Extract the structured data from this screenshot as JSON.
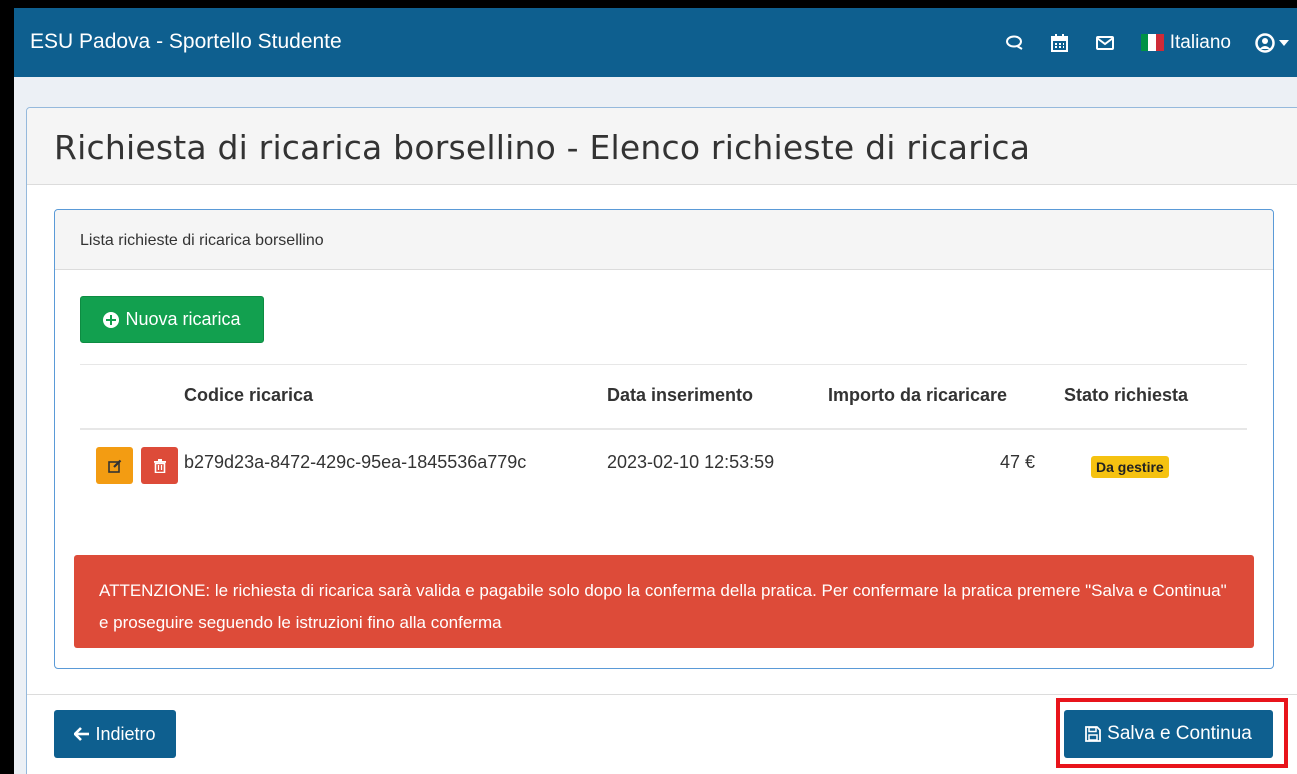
{
  "app": {
    "title": "ESU Padova - Sportello Studente",
    "language": "Italiano",
    "nav_icons": [
      "comments-icon",
      "calendar-icon",
      "envelope-icon",
      "user-circle-icon"
    ],
    "brand_color": "#0e5f8f"
  },
  "page": {
    "title": "Richiesta di ricarica borsellino - Elenco richieste di ricarica"
  },
  "panel": {
    "heading": "Lista richieste di ricarica borsellino",
    "new_button_label": "Nuova ricarica"
  },
  "table": {
    "headers": [
      "Codice ricarica",
      "Data inserimento",
      "Importo da ricaricare",
      "Stato richiesta"
    ],
    "rows": [
      {
        "code": "b279d23a-8472-429c-95ea-1845536a779c",
        "date": "2023-02-10 12:53:59",
        "amount": "47 €",
        "status": "Da gestire"
      }
    ]
  },
  "alert": {
    "text": "ATTENZIONE: le richiesta di ricarica sarà valida e pagabile solo dopo la conferma della pratica. Per confermare la pratica premere \"Salva e Continua\" e proseguire seguendo le istruzioni fino alla conferma"
  },
  "footer": {
    "back_label": "Indietro",
    "save_label": "Salva e Continua"
  },
  "colors": {
    "success": "#12a04f",
    "warning": "#f39c12",
    "danger": "#dd4b39",
    "badge": "#f5c211",
    "highlight": "#e8141b"
  }
}
